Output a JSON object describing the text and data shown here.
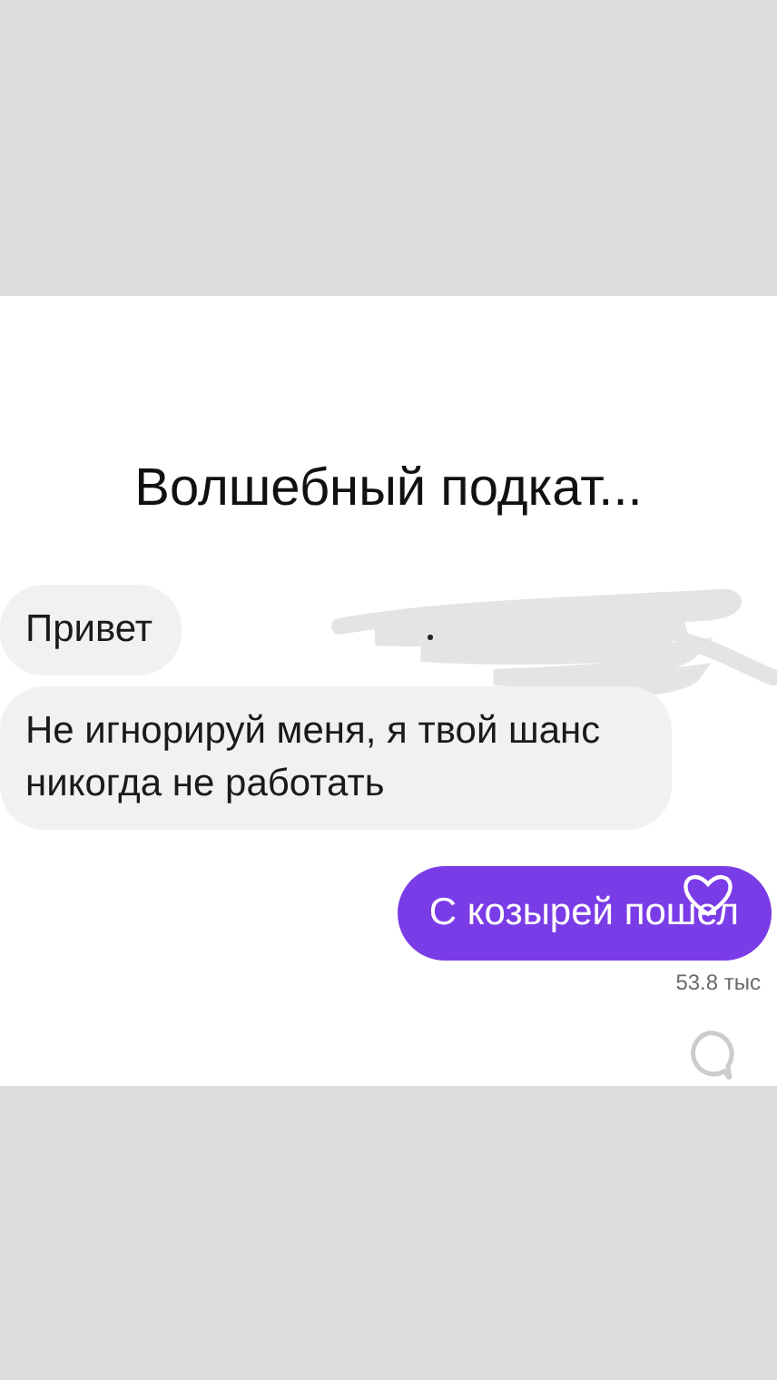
{
  "title": "Волшебный подкат...",
  "messages": [
    {
      "kind": "incoming",
      "text": "Привет"
    },
    {
      "kind": "incoming",
      "text": "Не игнорируй меня, я твой шанс никогда не работать"
    },
    {
      "kind": "outgoing",
      "text": "С козырей пошел",
      "likes": "53.8 тыс"
    }
  ]
}
